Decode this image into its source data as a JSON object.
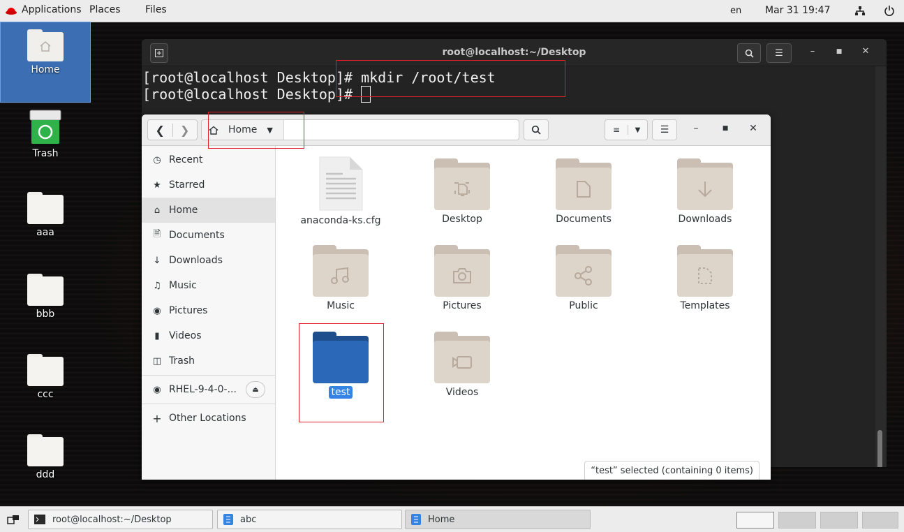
{
  "topbar": {
    "applications": "Applications",
    "places": "Places",
    "files": "Files",
    "lang": "en",
    "clock": "Mar 31 19:47"
  },
  "desktop": {
    "icons": [
      {
        "label": "Home"
      },
      {
        "label": "Trash"
      },
      {
        "label": "aaa"
      },
      {
        "label": "bbb"
      },
      {
        "label": "ccc"
      },
      {
        "label": "ddd"
      }
    ]
  },
  "terminal": {
    "title": "root@localhost:~/Desktop",
    "line1": "[root@localhost Desktop]# mkdir /root/test",
    "line2": "[root@localhost Desktop]# "
  },
  "files": {
    "path_home": "Home",
    "sidebar": [
      {
        "label": "Recent",
        "icon": "clock-icon"
      },
      {
        "label": "Starred",
        "icon": "star-icon"
      },
      {
        "label": "Home",
        "icon": "home-icon"
      },
      {
        "label": "Documents",
        "icon": "document-icon"
      },
      {
        "label": "Downloads",
        "icon": "download-icon"
      },
      {
        "label": "Music",
        "icon": "music-icon"
      },
      {
        "label": "Pictures",
        "icon": "camera-icon"
      },
      {
        "label": "Videos",
        "icon": "video-icon"
      },
      {
        "label": "Trash",
        "icon": "trash-icon"
      },
      {
        "label": "RHEL-9-4-0-...",
        "icon": "disc-icon"
      },
      {
        "label": "Other Locations",
        "icon": "plus-icon"
      }
    ],
    "items": [
      {
        "name": "anaconda-ks.cfg"
      },
      {
        "name": "Desktop"
      },
      {
        "name": "Documents"
      },
      {
        "name": "Downloads"
      },
      {
        "name": "Music"
      },
      {
        "name": "Pictures"
      },
      {
        "name": "Public"
      },
      {
        "name": "Templates"
      },
      {
        "name": "test"
      },
      {
        "name": "Videos"
      }
    ],
    "status": "“test” selected  (containing 0 items)"
  },
  "taskbar": {
    "tasks": [
      {
        "label": "root@localhost:~/Desktop"
      },
      {
        "label": "abc"
      },
      {
        "label": "Home"
      }
    ]
  },
  "colors": {
    "accent": "#3584e4",
    "highlight": "#e0202a",
    "folder": "#ddd4ca",
    "selected_folder": "#2b68b8"
  }
}
